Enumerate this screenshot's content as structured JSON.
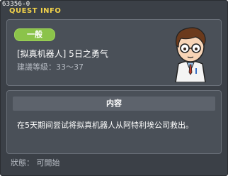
{
  "window": {
    "id_text": "63356-0",
    "title": "QUEST INFO"
  },
  "quest": {
    "category": "一般",
    "name": "[拟真机器人] 5日之勇气",
    "level_text": "建議等級：33～37"
  },
  "content": {
    "header": "内容",
    "text": "在5天期间尝试将拟真机器人从阿特利埃公司救出。"
  },
  "status": {
    "text": "狀態： 可開始"
  },
  "colors": {
    "title": "#f2d24a",
    "badge": "#8bc34a",
    "panel": "#4a5058",
    "window": "#3b4047"
  },
  "icons": {
    "npc": "scientist-npc-portrait"
  }
}
